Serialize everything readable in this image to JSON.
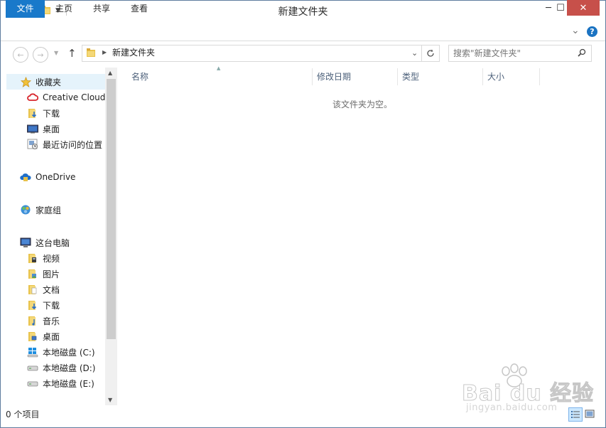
{
  "window": {
    "title": "新建文件夹",
    "minimize_symbol": "─",
    "maximize_symbol": "☐",
    "close_symbol": "✕"
  },
  "ribbon": {
    "tabs": [
      "文件",
      "主页",
      "共享",
      "查看"
    ],
    "expand_symbol": "⌄",
    "help_symbol": "?"
  },
  "navigation": {
    "back_symbol": "←",
    "forward_symbol": "→",
    "up_symbol": "↑",
    "breadcrumb": [
      "新建文件夹"
    ],
    "search_placeholder": "搜索\"新建文件夹\""
  },
  "nav_pane": {
    "favorites_label": "收藏夹",
    "favorites": [
      {
        "label": "Creative Cloud",
        "icon": "creative-cloud-icon"
      },
      {
        "label": "下载",
        "icon": "downloads-folder-icon"
      },
      {
        "label": "桌面",
        "icon": "desktop-icon"
      },
      {
        "label": "最近访问的位置",
        "icon": "recent-places-icon"
      }
    ],
    "onedrive_label": "OneDrive",
    "homegroup_label": "家庭组",
    "this_pc_label": "这台电脑",
    "this_pc_items": [
      {
        "label": "视频",
        "icon": "videos-folder-icon"
      },
      {
        "label": "图片",
        "icon": "pictures-folder-icon"
      },
      {
        "label": "文档",
        "icon": "documents-folder-icon"
      },
      {
        "label": "下载",
        "icon": "downloads-folder-icon"
      },
      {
        "label": "音乐",
        "icon": "music-folder-icon"
      },
      {
        "label": "桌面",
        "icon": "desktop-folder-icon"
      },
      {
        "label": "本地磁盘 (C:)",
        "icon": "windows-drive-icon"
      },
      {
        "label": "本地磁盘 (D:)",
        "icon": "drive-icon"
      },
      {
        "label": "本地磁盘 (E:)",
        "icon": "drive-icon"
      }
    ]
  },
  "content": {
    "columns": [
      "名称",
      "修改日期",
      "类型",
      "大小"
    ],
    "empty_message": "该文件夹为空。"
  },
  "status": {
    "item_count": "0 个项目"
  },
  "watermark": {
    "brand": "Bai du 经验",
    "url": "jingyan.baidu.com"
  },
  "colors": {
    "file_tab": "#1979ca",
    "close_button": "#c7504a",
    "selection": "#e5f3fb",
    "header_text": "#4c607a"
  }
}
